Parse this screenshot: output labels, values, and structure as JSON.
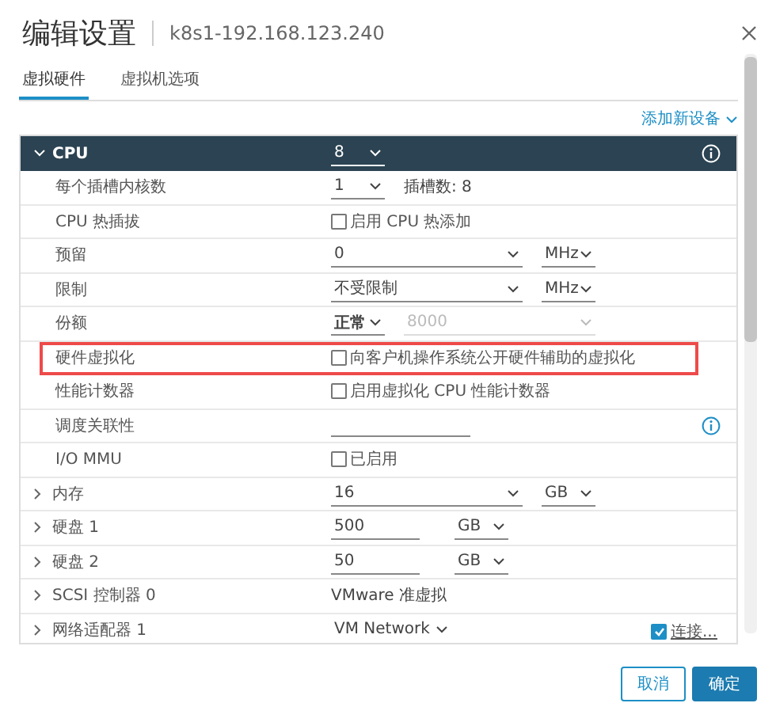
{
  "dialog": {
    "title": "编辑设置",
    "subtitle": "k8s1-192.168.123.240"
  },
  "tabs": [
    {
      "label": "虚拟硬件",
      "selected": true
    },
    {
      "label": "虚拟机选项",
      "selected": false
    }
  ],
  "add_device": "添加新设备",
  "cpu": {
    "label": "CPU",
    "value": "8",
    "expanded": true
  },
  "rows": [
    {
      "label": "每个插槽内核数",
      "kind": "sub",
      "highlighted": false,
      "info": false,
      "controls": [
        {
          "kind": "select",
          "value": "1",
          "bold": false
        },
        {
          "kind": "note",
          "text": "插槽数: 8"
        }
      ]
    },
    {
      "label": "CPU 热插拔",
      "kind": "sub",
      "highlighted": false,
      "info": false,
      "controls": [
        {
          "kind": "checkbox",
          "text": "启用 CPU 热添加",
          "checked": false
        }
      ]
    },
    {
      "label": "预留",
      "kind": "sub",
      "highlighted": false,
      "info": false,
      "controls": [
        {
          "kind": "wide_select",
          "value": "0",
          "disabled": false
        },
        {
          "kind": "unit_select",
          "value": "MHz"
        }
      ]
    },
    {
      "label": "限制",
      "kind": "sub",
      "highlighted": false,
      "info": false,
      "controls": [
        {
          "kind": "wide_select",
          "value": "不受限制",
          "disabled": false
        },
        {
          "kind": "unit_select",
          "value": "MHz"
        }
      ]
    },
    {
      "label": "份额",
      "kind": "sub",
      "highlighted": false,
      "info": false,
      "controls": [
        {
          "kind": "select",
          "value": "正常",
          "bold": true
        },
        {
          "kind": "wide_select",
          "value": "8000",
          "disabled": true
        }
      ]
    },
    {
      "label": "硬件虚拟化",
      "kind": "sub",
      "highlighted": true,
      "info": false,
      "controls": [
        {
          "kind": "checkbox",
          "text": "向客户机操作系统公开硬件辅助的虚拟化",
          "checked": false
        }
      ]
    },
    {
      "label": "性能计数器",
      "kind": "sub",
      "highlighted": false,
      "info": false,
      "controls": [
        {
          "kind": "checkbox",
          "text": "启用虚拟化 CPU 性能计数器",
          "checked": false
        }
      ]
    },
    {
      "label": "调度关联性",
      "kind": "sub",
      "highlighted": false,
      "info": true,
      "controls": [
        {
          "kind": "blank_field"
        }
      ]
    },
    {
      "label": "I/O MMU",
      "kind": "sub",
      "highlighted": false,
      "info": false,
      "controls": [
        {
          "kind": "checkbox",
          "text": "已启用",
          "checked": false
        }
      ]
    },
    {
      "label": "内存",
      "kind": "device",
      "expanded": false,
      "highlighted": false,
      "info": false,
      "controls": [
        {
          "kind": "wide_select",
          "value": "16",
          "disabled": false
        },
        {
          "kind": "unit_select",
          "value": "GB"
        }
      ]
    },
    {
      "label": "硬盘 1",
      "kind": "device",
      "expanded": false,
      "highlighted": false,
      "info": false,
      "controls": [
        {
          "kind": "field",
          "value": "500"
        },
        {
          "kind": "unit_select",
          "value": "GB"
        }
      ]
    },
    {
      "label": "硬盘 2",
      "kind": "device",
      "expanded": false,
      "highlighted": false,
      "info": false,
      "controls": [
        {
          "kind": "field",
          "value": "50"
        },
        {
          "kind": "unit_select",
          "value": "GB"
        }
      ]
    },
    {
      "label": "SCSI 控制器 0",
      "kind": "device",
      "expanded": false,
      "highlighted": false,
      "info": false,
      "controls": [
        {
          "kind": "text",
          "text": "VMware 准虚拟"
        }
      ]
    },
    {
      "label": "网络适配器 1",
      "kind": "device",
      "expanded": false,
      "highlighted": false,
      "info": false,
      "controls": [
        {
          "kind": "plain_select",
          "value": "VM Network"
        },
        {
          "kind": "end_checkbox",
          "text": "连接...",
          "checked": true
        }
      ]
    }
  ],
  "buttons": [
    {
      "label": "取消",
      "kind": "secondary"
    },
    {
      "label": "确定",
      "kind": "primary"
    }
  ]
}
